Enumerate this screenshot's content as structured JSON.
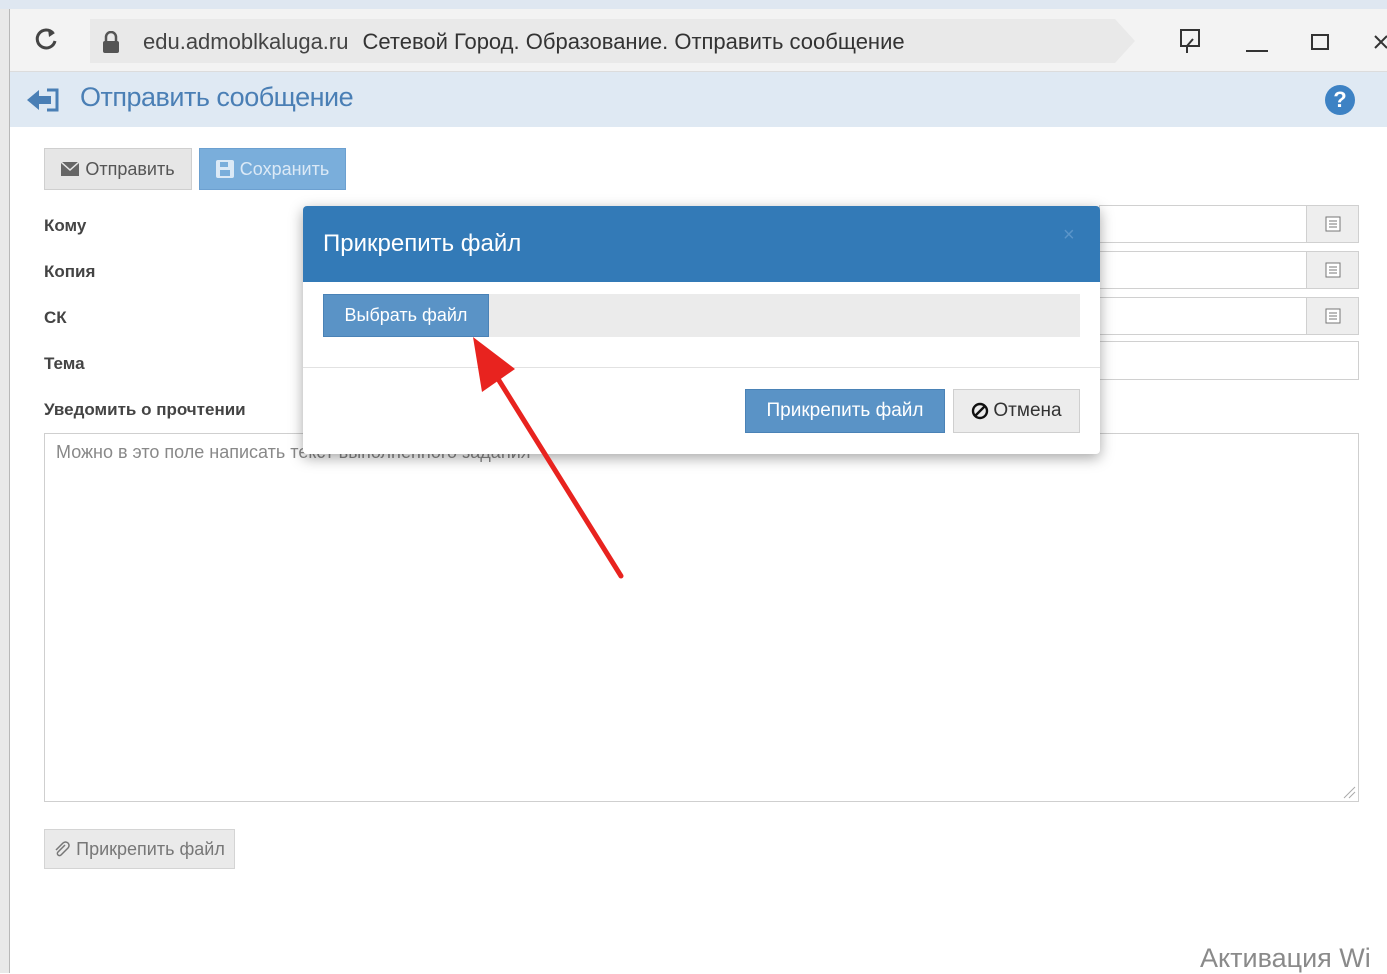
{
  "browser": {
    "domain": "edu.admoblkaluga.ru",
    "page_title": "Сетевой Город. Образование. Отправить сообщение"
  },
  "header": {
    "title": "Отправить сообщение"
  },
  "toolbar": {
    "send_label": "Отправить",
    "save_label": "Сохранить"
  },
  "form": {
    "to_label": "Кому",
    "cc_label": "Копия",
    "bcc_label": "СК",
    "topic_label": "Тема",
    "notify_label": "Уведомить о прочтении",
    "body_placeholder": "Можно в это поле написать текст выполненного задания",
    "attach_label": "Прикрепить файл"
  },
  "modal": {
    "title": "Прикрепить файл",
    "close": "×",
    "choose_file_label": "Выбрать файл",
    "attach_label": "Прикрепить файл",
    "cancel_label": "Отмена"
  },
  "watermark": "Активация Wi",
  "colors": {
    "modal_header": "#337ab7",
    "primary_button": "#5a93c6",
    "annotation_arrow": "#e8231f"
  }
}
